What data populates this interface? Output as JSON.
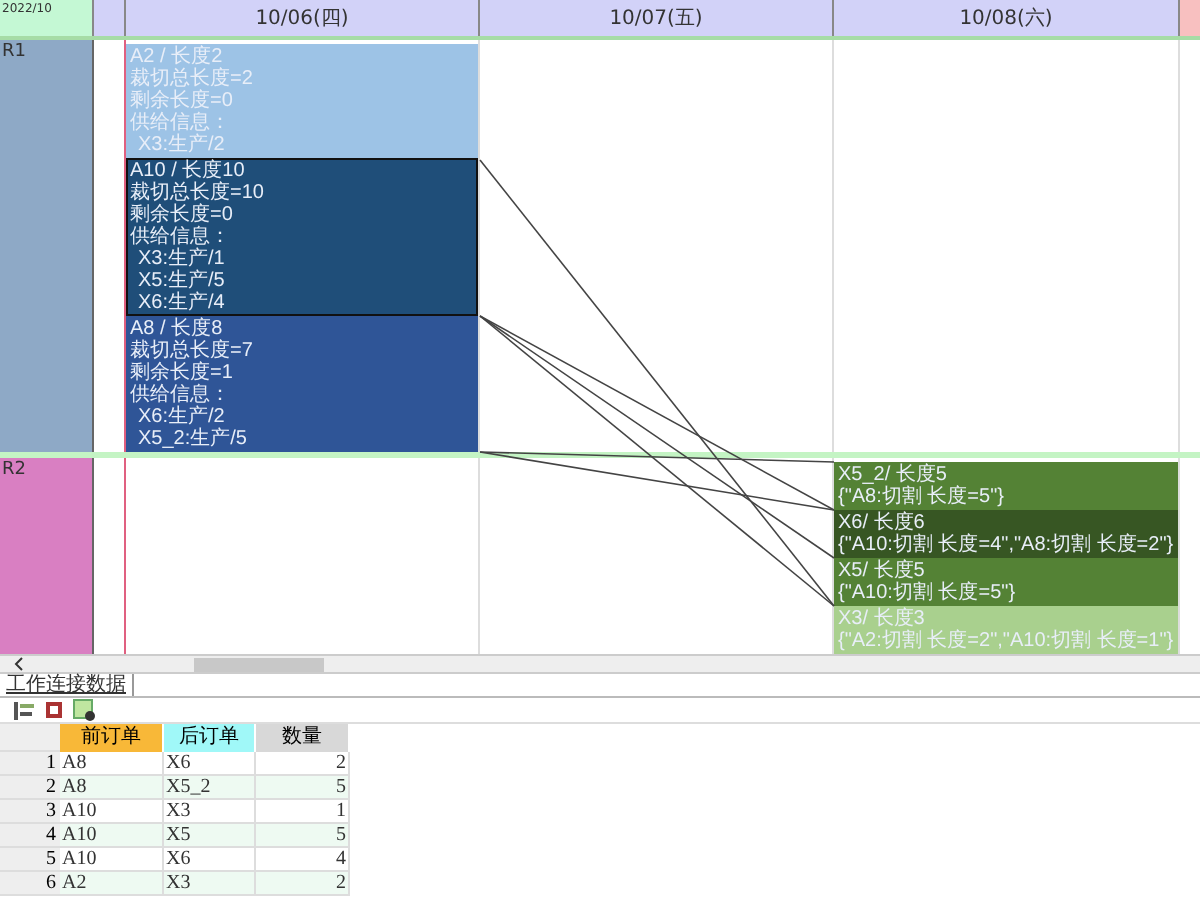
{
  "gantt": {
    "corner_label": "2022/10",
    "days": [
      "10/06(四)",
      "10/07(五)",
      "10/08(六)"
    ],
    "rows": [
      {
        "label": "R1",
        "color": "#8ea9c6",
        "tasks": [
          {
            "title": "A2 / 长度2",
            "lines": [
              "裁切总长度=2",
              "剩余长度=0",
              "供给信息："
            ],
            "supply": [
              "X3:生产/2"
            ],
            "color": "#9dc3e6",
            "selected": false
          },
          {
            "title": "A10 / 长度10",
            "lines": [
              "裁切总长度=10",
              "剩余长度=0",
              "供给信息："
            ],
            "supply": [
              "X3:生产/1",
              "X5:生产/5",
              "X6:生产/4"
            ],
            "color": "#1f4e79",
            "selected": true
          },
          {
            "title": "A8 / 长度8",
            "lines": [
              "裁切总长度=7",
              "剩余长度=1",
              "供给信息："
            ],
            "supply": [
              "X6:生产/2",
              "X5_2:生产/5"
            ],
            "color": "#2f5597",
            "selected": false
          }
        ]
      },
      {
        "label": "R2",
        "color": "#d97fc2",
        "tasks": [
          {
            "title": "X5_2/ 长度5",
            "lines": [
              "{\"A8:切割 长度=5\"}"
            ],
            "color": "#548235",
            "selected": false
          },
          {
            "title": "X6/ 长度6",
            "lines": [
              "{\"A10:切割 长度=4\",\"A8:切割 长度=2\"}"
            ],
            "color": "#375623",
            "selected": false
          },
          {
            "title": "X5/ 长度5",
            "lines": [
              "{\"A10:切割 长度=5\"}"
            ],
            "color": "#548235",
            "selected": false
          },
          {
            "title": "X3/ 长度3",
            "lines": [
              "{\"A2:切割 长度=2\",\"A10:切割 长度=1\"}"
            ],
            "color": "#a9d08e",
            "selected": false
          }
        ]
      }
    ]
  },
  "panel": {
    "tab": "工作连接数据",
    "table": {
      "columns": [
        {
          "label": "前订单",
          "color": "#f8b838"
        },
        {
          "label": "后订单",
          "color": "#a0f8f8"
        },
        {
          "label": "数量",
          "color": "#d8d8d8"
        }
      ],
      "rows": [
        {
          "number": "1",
          "cells": [
            "A8",
            "X6",
            "2"
          ]
        },
        {
          "number": "2",
          "cells": [
            "A8",
            "X5_2",
            "5"
          ]
        },
        {
          "number": "3",
          "cells": [
            "A10",
            "X3",
            "1"
          ]
        },
        {
          "number": "4",
          "cells": [
            "A10",
            "X5",
            "5"
          ]
        },
        {
          "number": "5",
          "cells": [
            "A10",
            "X6",
            "4"
          ]
        },
        {
          "number": "6",
          "cells": [
            "A2",
            "X3",
            "2"
          ]
        }
      ]
    }
  }
}
